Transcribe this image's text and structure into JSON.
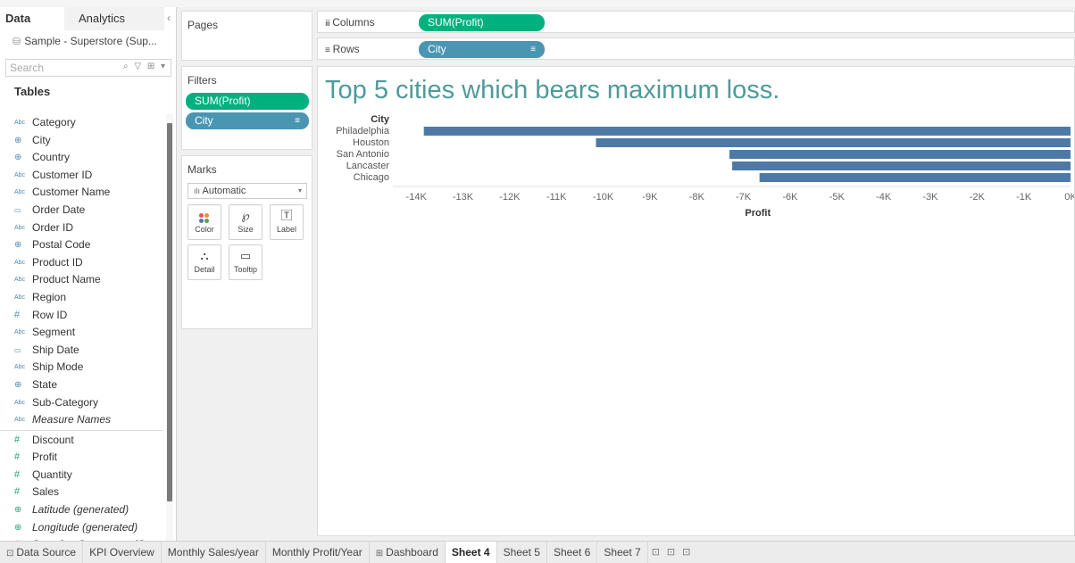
{
  "data_pane": {
    "tab_data": "Data",
    "tab_analytics": "Analytics",
    "collapse": "‹",
    "data_source": "Sample - Superstore (Sup...",
    "search_placeholder": "Search",
    "tables_heading": "Tables",
    "dimensions": [
      {
        "icon": "Abc",
        "label": "Category",
        "italic": false
      },
      {
        "icon": "⊕",
        "label": "City",
        "italic": false
      },
      {
        "icon": "⊕",
        "label": "Country",
        "italic": false
      },
      {
        "icon": "Abc",
        "label": "Customer ID",
        "italic": false
      },
      {
        "icon": "Abc",
        "label": "Customer Name",
        "italic": false
      },
      {
        "icon": "▭",
        "label": "Order Date",
        "italic": false
      },
      {
        "icon": "Abc",
        "label": "Order ID",
        "italic": false
      },
      {
        "icon": "⊕",
        "label": "Postal Code",
        "italic": false
      },
      {
        "icon": "Abc",
        "label": "Product ID",
        "italic": false
      },
      {
        "icon": "Abc",
        "label": "Product Name",
        "italic": false
      },
      {
        "icon": "Abc",
        "label": "Region",
        "italic": false
      },
      {
        "icon": "#",
        "label": "Row ID",
        "italic": false
      },
      {
        "icon": "Abc",
        "label": "Segment",
        "italic": false
      },
      {
        "icon": "▭",
        "label": "Ship Date",
        "italic": false
      },
      {
        "icon": "Abc",
        "label": "Ship Mode",
        "italic": false
      },
      {
        "icon": "⊕",
        "label": "State",
        "italic": false
      },
      {
        "icon": "Abc",
        "label": "Sub-Category",
        "italic": false
      },
      {
        "icon": "Abc",
        "label": "Measure Names",
        "italic": true
      }
    ],
    "measures": [
      {
        "icon": "#",
        "label": "Discount",
        "italic": false
      },
      {
        "icon": "#",
        "label": "Profit",
        "italic": false
      },
      {
        "icon": "#",
        "label": "Quantity",
        "italic": false
      },
      {
        "icon": "#",
        "label": "Sales",
        "italic": false
      },
      {
        "icon": "⊕",
        "label": "Latitude (generated)",
        "italic": true
      },
      {
        "icon": "⊕",
        "label": "Longitude (generated)",
        "italic": true
      },
      {
        "icon": "#",
        "label": "Sample - Superstore (Co...",
        "italic": true
      }
    ]
  },
  "pages_card": {
    "title": "Pages"
  },
  "filters_card": {
    "title": "Filters",
    "pill_profit": "SUM(Profit)",
    "pill_city": "City"
  },
  "marks_card": {
    "title": "Marks",
    "mark_type": "Automatic",
    "buttons": {
      "color": "Color",
      "size": "Size",
      "label": "Label",
      "detail": "Detail",
      "tooltip": "Tooltip"
    }
  },
  "shelves": {
    "columns_label": "Columns",
    "columns_pill": "SUM(Profit)",
    "rows_label": "Rows",
    "rows_pill": "City"
  },
  "view": {
    "title": "Top 5 cities which bears maximum loss."
  },
  "chart_data": {
    "type": "bar",
    "orientation": "horizontal",
    "title": "Top 5 cities which bears maximum loss.",
    "row_header": "City",
    "xlabel": "Profit",
    "categories": [
      "Philadelphia",
      "Houston",
      "San Antonio",
      "Lancaster",
      "Chicago"
    ],
    "values": [
      -13838,
      -10154,
      -7299,
      -7240,
      -6655
    ],
    "xlim": [
      -14500,
      0
    ],
    "ticks": [
      -14000,
      -13000,
      -12000,
      -11000,
      -10000,
      -9000,
      -8000,
      -7000,
      -6000,
      -5000,
      -4000,
      -3000,
      -2000,
      -1000,
      0
    ],
    "tick_labels": [
      "-14K",
      "-13K",
      "-12K",
      "-11K",
      "-10K",
      "-9K",
      "-8K",
      "-7K",
      "-6K",
      "-5K",
      "-4K",
      "-3K",
      "-2K",
      "-1K",
      "0K"
    ],
    "bar_color": "#4e79a7"
  },
  "tabs": [
    {
      "label": "Data Source",
      "icon": "⊡",
      "active": false
    },
    {
      "label": "KPI Overview",
      "icon": "",
      "active": false
    },
    {
      "label": "Monthly Sales/year",
      "icon": "",
      "active": false
    },
    {
      "label": "Monthly Profit/Year",
      "icon": "",
      "active": false
    },
    {
      "label": "Dashboard",
      "icon": "⊞",
      "active": false
    },
    {
      "label": "Sheet 4",
      "icon": "",
      "active": true
    },
    {
      "label": "Sheet 5",
      "icon": "",
      "active": false
    },
    {
      "label": "Sheet 6",
      "icon": "",
      "active": false
    },
    {
      "label": "Sheet 7",
      "icon": "",
      "active": false
    }
  ],
  "colors": {
    "green_pill": "#00b180",
    "blue_pill": "#4996b2",
    "title": "#4f9a9a"
  }
}
